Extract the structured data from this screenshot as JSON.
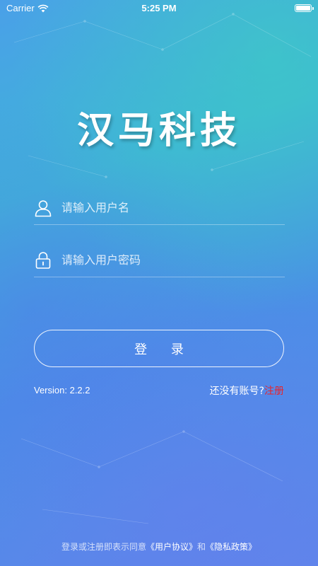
{
  "status_bar": {
    "carrier": "Carrier",
    "time": "5:25 PM"
  },
  "app": {
    "title": "汉马科技"
  },
  "login_form": {
    "username_placeholder": "请输入用户名",
    "password_placeholder": "请输入用户密码",
    "login_label": "登 录"
  },
  "footer": {
    "version": "Version: 2.2.2",
    "no_account_text": "还没有账号?",
    "register_label": "注册"
  },
  "agreement": {
    "prefix": "登录或注册即表示同意",
    "user_agreement": "《用户协议》",
    "and": "和",
    "privacy_policy": "《隐私政策》"
  },
  "colors": {
    "register_link": "#e8242c",
    "accent_teal": "#3cc8c0",
    "accent_blue": "#5d86ea"
  },
  "icons": {
    "username": "user-icon",
    "password": "lock-icon",
    "wifi": "wifi-icon",
    "battery": "battery-icon"
  }
}
